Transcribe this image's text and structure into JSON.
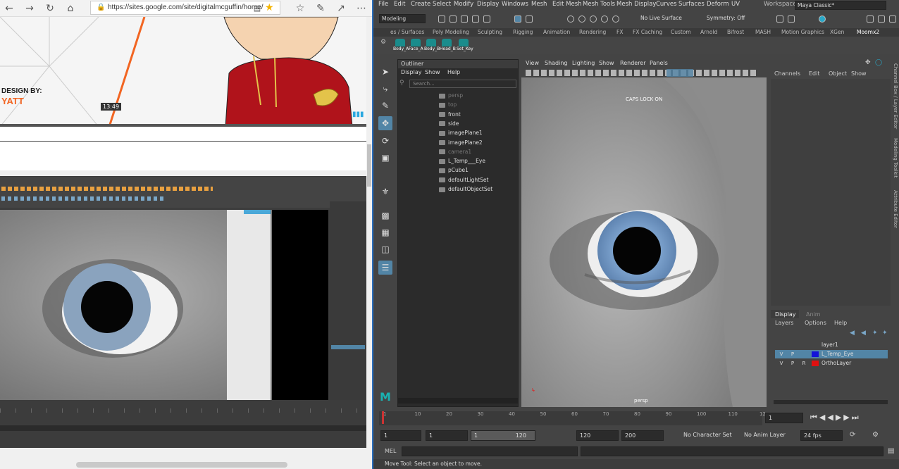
{
  "browser": {
    "url": "https://sites.google.com/site/digitalmcguffin/home/",
    "slide": {
      "design_by": "DESIGN BY:",
      "name": "YATT",
      "timestamp": "13:49"
    }
  },
  "maya": {
    "menubar": [
      "File",
      "Edit",
      "Create",
      "Select",
      "Modify",
      "Display",
      "Windows",
      "Mesh",
      "Edit Mesh",
      "Mesh Tools",
      "Mesh Display",
      "Curves",
      "Surfaces",
      "Deform",
      "UV"
    ],
    "workspace_label": "Workspace :",
    "workspace_value": "Maya Classic*",
    "mode": "Modeling",
    "live_surface": "No Live Surface",
    "symmetry": "Symmetry: Off",
    "shelf_tabs": [
      "es / Surfaces",
      "Poly Modeling",
      "Sculpting",
      "Rigging",
      "Animation",
      "Rendering",
      "FX",
      "FX Caching",
      "Custom",
      "Arnold",
      "Bifrost",
      "MASH",
      "Motion Graphics",
      "XGen",
      "Moomx2"
    ],
    "shelf_buttons": [
      "Body_A",
      "Face_A",
      "Body_B",
      "Head_B",
      "Set_Key"
    ],
    "outliner": {
      "title": "Outliner",
      "menus": [
        "Display",
        "Show",
        "Help"
      ],
      "search_placeholder": "Search...",
      "items": [
        {
          "label": "persp",
          "dim": true
        },
        {
          "label": "top",
          "dim": true
        },
        {
          "label": "front",
          "dim": false
        },
        {
          "label": "side",
          "dim": false
        },
        {
          "label": "imagePlane1",
          "dim": false
        },
        {
          "label": "imagePlane2",
          "dim": false
        },
        {
          "label": "camera1",
          "dim": true
        },
        {
          "label": "L_Temp___Eye",
          "dim": false
        },
        {
          "label": "pCube1",
          "dim": false
        },
        {
          "label": "defaultLightSet",
          "dim": false
        },
        {
          "label": "defaultObjectSet",
          "dim": false
        }
      ]
    },
    "view_menu": [
      "View",
      "Shading",
      "Lighting",
      "Show",
      "Renderer",
      "Panels"
    ],
    "viewport": {
      "caps_lock": "CAPS LOCK ON",
      "camera": "persp"
    },
    "channel_menu": [
      "Channels",
      "Edit",
      "Object",
      "Show"
    ],
    "layer_tabs": [
      "Display",
      "Anim"
    ],
    "layer_menu": [
      "Layers",
      "Options",
      "Help"
    ],
    "layers": [
      {
        "v": "",
        "p": "",
        "r": "",
        "name": "layer1",
        "color": "#444444",
        "selected": false
      },
      {
        "v": "V",
        "p": "P",
        "r": "",
        "name": "L_Temp_Eye",
        "color": "#1414d8",
        "selected": true
      },
      {
        "v": "V",
        "p": "P",
        "r": "R",
        "name": "OrthoLayer",
        "color": "#e01010",
        "selected": false
      }
    ],
    "side_tabs": [
      "Channel Box / Layer Editor",
      "Modeling Toolkit",
      "Attribute Editor"
    ],
    "timeline_ticks": [
      "1",
      "10",
      "20",
      "30",
      "40",
      "50",
      "60",
      "70",
      "80",
      "90",
      "100",
      "110",
      "12"
    ],
    "current_frame": "1",
    "range": {
      "start": "1",
      "inner_start": "1",
      "slider_start": "1",
      "slider_end": "120",
      "end": "120",
      "max": "200"
    },
    "character_set": "No Character Set",
    "anim_layer": "No Anim Layer",
    "fps": "24 fps",
    "cmd_label": "MEL",
    "help_line": "Move Tool: Select an object to move."
  }
}
